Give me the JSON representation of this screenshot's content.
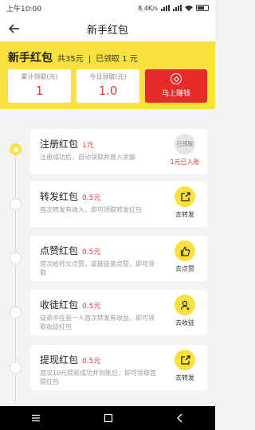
{
  "status_bar": {
    "time": "上午10:00",
    "speed": "8.4K/s"
  },
  "nav": {
    "title": "新手红包"
  },
  "summary": {
    "title": "新手红包",
    "total": "共35元",
    "divider": "|",
    "received": "已领取 1 元",
    "cards": [
      {
        "label": "累计领取(元)",
        "value": "1"
      },
      {
        "label": "今日领取(元)",
        "value": "1.0"
      }
    ],
    "earn_button": "马上赚钱"
  },
  "tasks": [
    {
      "name": "注册红包",
      "amount": "1元",
      "desc": "注册成功后，自动领取并放入余额",
      "badge": "已领取",
      "action": "1元已入账",
      "icon": "received-badge"
    },
    {
      "name": "转发红包",
      "amount": "0.5元",
      "desc": "首次转发有收入，即可领取转发红包",
      "action": "去转发",
      "icon": "share-icon"
    },
    {
      "name": "点赞红包",
      "amount": "0.5元",
      "desc": "首次给师父点赞，或被徒弟点赞，即可领取",
      "action": "去点赞",
      "icon": "thumbs-up-icon"
    },
    {
      "name": "收徒红包",
      "amount": "0.5元",
      "desc": "徒弟中任意一人首次转发有收益，即可领取收徒红包",
      "action": "去收徒",
      "icon": "add-user-icon"
    },
    {
      "name": "提现红包",
      "amount": "0.5元",
      "desc": "首次10元提现成功并到账后，即可领取首提红包",
      "action": "去转发",
      "icon": "share-icon"
    }
  ],
  "colors": {
    "accent": "#fbe13f",
    "red": "#e62b2b",
    "amount": "#e53a3a"
  }
}
